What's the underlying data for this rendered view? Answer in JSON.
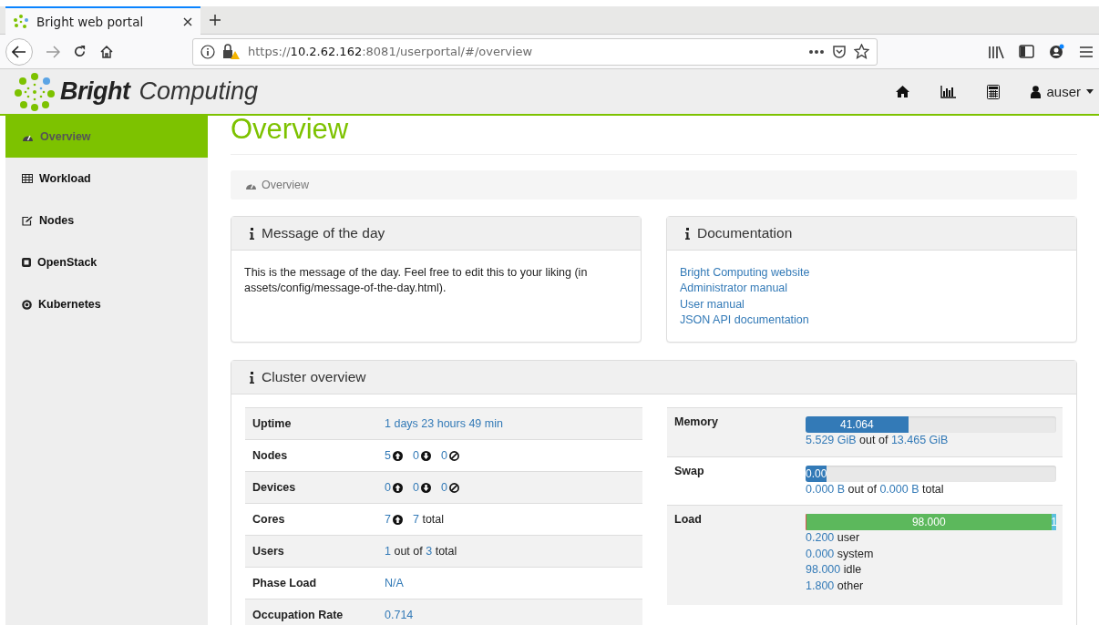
{
  "browser": {
    "tab": {
      "title": "Bright web portal"
    },
    "url": "https://**10.2.62.162**:8081/userportal/#/overview"
  },
  "header": {
    "brand": {
      "bold": "Bright",
      "light": "Computing"
    },
    "user": "auser"
  },
  "sidebar": {
    "items": [
      {
        "label": "Overview",
        "kind": "dashboard",
        "selected": true
      },
      {
        "label": "Workload",
        "kind": "table",
        "selected": false
      },
      {
        "label": "Nodes",
        "kind": "edit",
        "selected": false
      },
      {
        "label": "OpenStack",
        "kind": "stop",
        "selected": false
      },
      {
        "label": "Kubernetes",
        "kind": "gear",
        "selected": false
      }
    ]
  },
  "page": {
    "title": "Overview",
    "breadcrumb": "Overview"
  },
  "motd": {
    "title": "Message of the day",
    "text": "This is the message of the day. Feel free to edit this to your liking (in assets/config/message-of-the-day.html)."
  },
  "documentation": {
    "title": "Documentation",
    "links": [
      "Bright Computing website",
      "Administrator manual",
      "User manual",
      "JSON API documentation"
    ]
  },
  "cluster": {
    "title": "Cluster overview",
    "stats": [
      {
        "label": "Uptime",
        "value": [
          {
            "text": "1 days 23 hours 49 min",
            "kind": "link"
          }
        ]
      },
      {
        "label": "Nodes",
        "value": [
          {
            "text": "5",
            "kind": "link"
          },
          {
            "kind": "up"
          },
          {
            "text": "0",
            "kind": "link"
          },
          {
            "kind": "down"
          },
          {
            "text": "0",
            "kind": "link"
          },
          {
            "kind": "off"
          }
        ]
      },
      {
        "label": "Devices",
        "value": [
          {
            "text": "0",
            "kind": "link"
          },
          {
            "kind": "up"
          },
          {
            "text": "0",
            "kind": "link"
          },
          {
            "kind": "down"
          },
          {
            "text": "0",
            "kind": "link"
          },
          {
            "kind": "off"
          }
        ]
      },
      {
        "label": "Cores",
        "value": [
          {
            "text": "7",
            "kind": "link"
          },
          {
            "kind": "up"
          },
          {
            "text": "7",
            "kind": "link"
          },
          {
            "text": "total",
            "kind": "plain"
          }
        ]
      },
      {
        "label": "Users",
        "value": [
          {
            "text": "1",
            "kind": "link"
          },
          {
            "text": "out of",
            "kind": "plain"
          },
          {
            "text": "3",
            "kind": "link"
          },
          {
            "text": "total",
            "kind": "plain"
          }
        ]
      },
      {
        "label": "Phase Load",
        "value": [
          {
            "text": "N/A",
            "kind": "link"
          }
        ]
      },
      {
        "label": "Occupation Rate",
        "value": [
          {
            "text": "0.714",
            "kind": "link"
          }
        ]
      }
    ],
    "resources": [
      {
        "label": "Memory",
        "bar": [
          {
            "level": 0.41,
            "label": "41.064",
            "color": "#337ab7"
          }
        ],
        "details": [
          [
            {
              "text": "5.529 GiB",
              "kind": "link"
            },
            {
              "text": "out of",
              "kind": "plain"
            },
            {
              "text": "13.465 GiB",
              "kind": "link"
            }
          ]
        ]
      },
      {
        "label": "Swap",
        "bar": [
          {
            "level": 0.085,
            "label": "0.00",
            "color": "#337ab7"
          }
        ],
        "details": [
          [
            {
              "text": "0.000 B",
              "kind": "link"
            },
            {
              "text": "out of",
              "kind": "plain"
            },
            {
              "text": "0.000 B",
              "kind": "link"
            },
            {
              "text": "total",
              "kind": "plain"
            }
          ]
        ]
      },
      {
        "label": "Load",
        "bar": [
          {
            "level": 0.002,
            "color": "#d9534f"
          },
          {
            "level": 0.98,
            "label": "98.000",
            "color": "#5cb85c"
          },
          {
            "level": 0.018,
            "label": "1",
            "color": "#5bc0de"
          }
        ],
        "details": [
          [
            {
              "text": "0.200",
              "kind": "link"
            },
            {
              "text": "user",
              "kind": "plain"
            }
          ],
          [
            {
              "text": "0.000",
              "kind": "link"
            },
            {
              "text": "system",
              "kind": "plain"
            }
          ],
          [
            {
              "text": "98.000",
              "kind": "link"
            },
            {
              "text": "idle",
              "kind": "plain"
            }
          ],
          [
            {
              "text": "1.800",
              "kind": "link"
            },
            {
              "text": "other",
              "kind": "plain"
            }
          ]
        ]
      }
    ]
  }
}
